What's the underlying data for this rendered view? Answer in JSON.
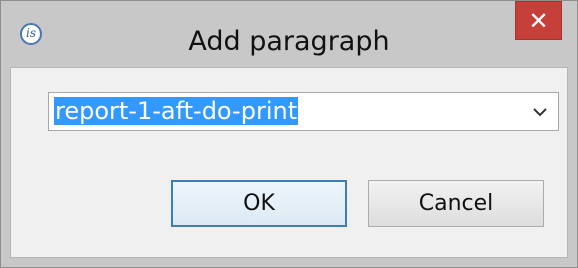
{
  "dialog": {
    "title": "Add paragraph",
    "app_icon_text": "is",
    "close_label": "✕"
  },
  "combo": {
    "value": "report-1-aft-do-print",
    "arrow_icon": "chevron-down-icon"
  },
  "buttons": {
    "ok_label": "OK",
    "cancel_label": "Cancel"
  },
  "colors": {
    "close_button": "#c6403a",
    "selection": "#3399ff",
    "ok_border": "#3c7fb1"
  }
}
